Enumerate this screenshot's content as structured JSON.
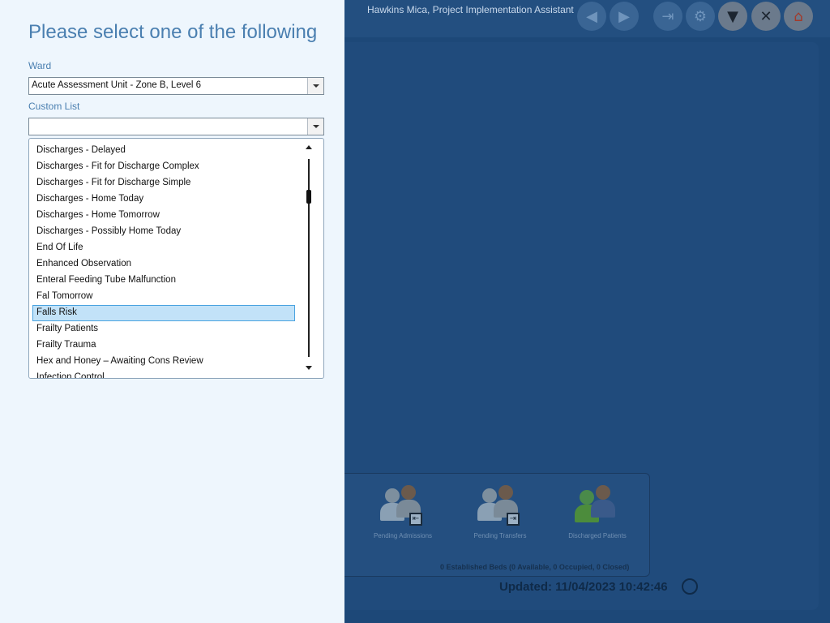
{
  "header": {
    "user_name": "Hawkins Mica, Project Implementation Assistant",
    "buttons": [
      {
        "name": "back-icon",
        "glyph": "◀"
      },
      {
        "name": "forward-icon",
        "glyph": "▶"
      },
      {
        "name": "exit-icon",
        "glyph": "⇥"
      },
      {
        "name": "settings-icon",
        "glyph": "⚙"
      },
      {
        "name": "filter-icon",
        "glyph": "▼"
      },
      {
        "name": "close-icon",
        "glyph": "✕"
      },
      {
        "name": "home-icon",
        "glyph": "⌂"
      }
    ]
  },
  "dashboard": {
    "tiles": [
      {
        "label": "Pending Admissions"
      },
      {
        "label": "Pending Transfers"
      },
      {
        "label": "Discharged Patients"
      }
    ],
    "beds_summary": "0 Established Beds (0 Available, 0 Occupied, 0 Closed)",
    "updated": "Updated: 11/04/2023 10:42:46"
  },
  "flyout": {
    "title": "Please select one of the following",
    "ward_label": "Ward",
    "ward_value": "Acute Assessment Unit - Zone B, Level 6",
    "custom_list_label": "Custom List",
    "custom_list_value": "",
    "options": [
      "Discharges - Delayed",
      "Discharges - Fit for Discharge Complex",
      "Discharges - Fit for Discharge Simple",
      "Discharges - Home Today",
      "Discharges - Home Tomorrow",
      "Discharges - Possibly Home Today",
      "End Of Life",
      "Enhanced Observation",
      "Enteral Feeding Tube Malfunction",
      "Fal Tomorrow",
      "Falls Risk",
      "Frailty Patients",
      "Frailty Trauma",
      "Hex and Honey – Awaiting Cons Review",
      "Infection Control"
    ],
    "selected_index": 10
  },
  "colors": {
    "accent": "#4a7fb0",
    "selection": "#c2e2f8",
    "selection_border": "#4aa3e0"
  }
}
